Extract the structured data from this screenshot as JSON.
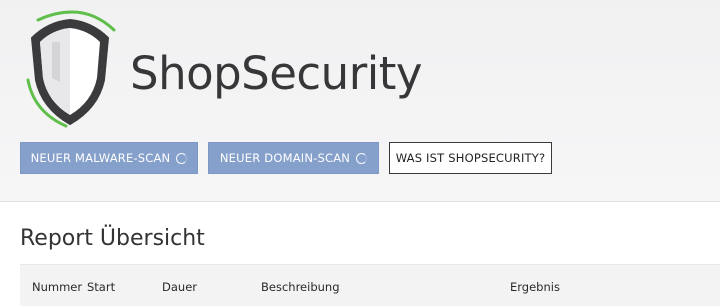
{
  "brand": {
    "name": "ShopSecurity",
    "logo_icon": "shield-logo-icon"
  },
  "actions": {
    "malware_scan": "Neuer Malware-Scan",
    "domain_scan": "Neuer Domain-Scan",
    "about": "Was ist ShopSecurity?"
  },
  "report": {
    "title": "Report Übersicht",
    "columns": [
      "Nummer",
      "Start",
      "Dauer",
      "Beschreibung",
      "Ergebnis"
    ]
  },
  "colors": {
    "primary_button": "#86a0cc",
    "logo_accent": "#5fbf4a",
    "text": "#37373a"
  }
}
